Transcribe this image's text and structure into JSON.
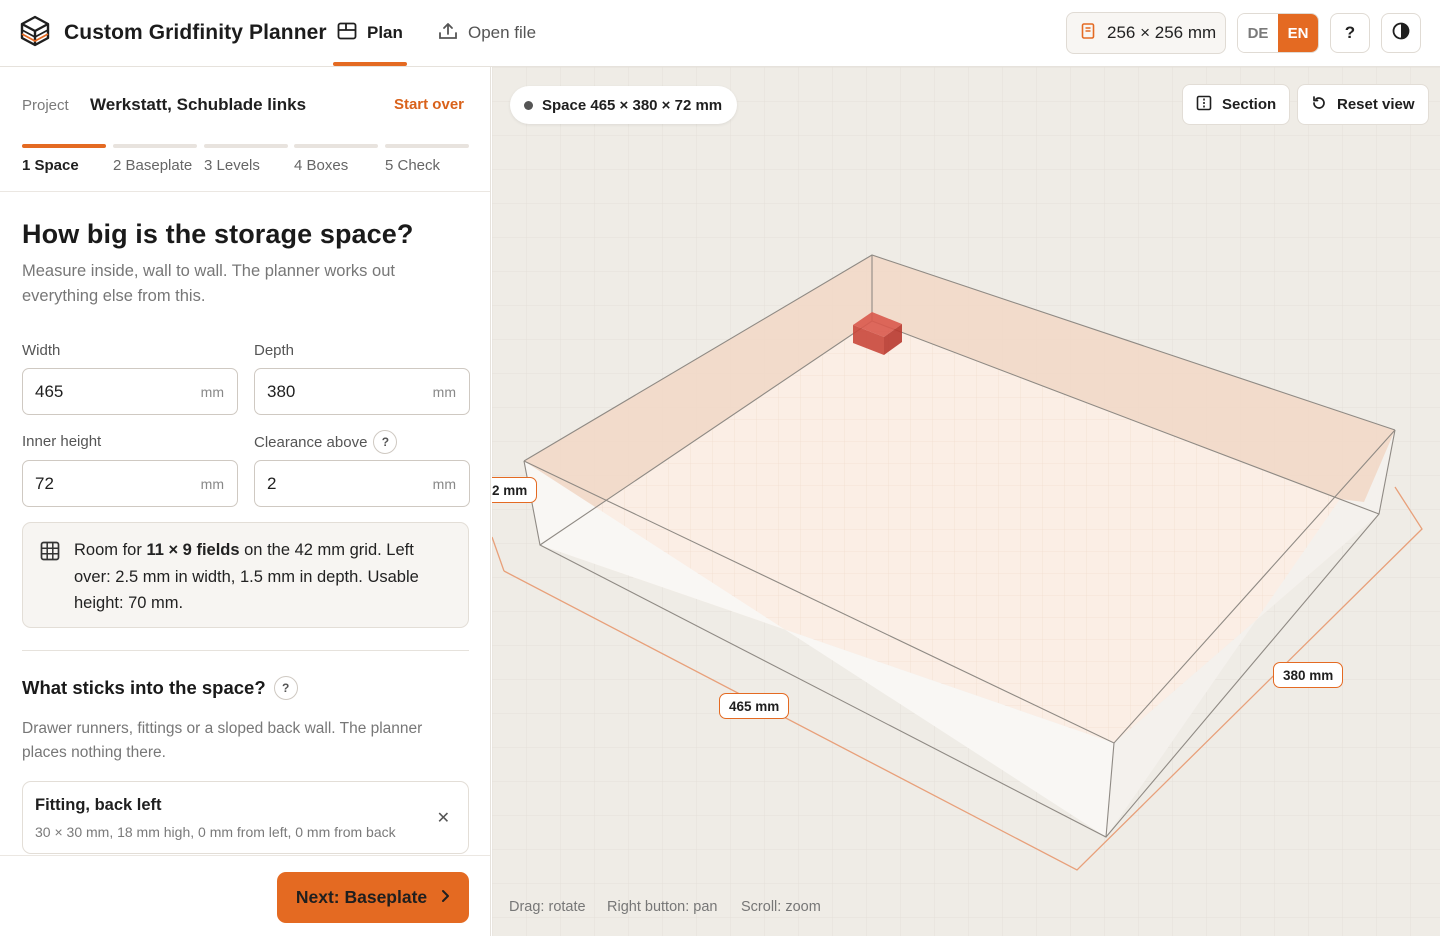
{
  "app": {
    "title": "Custom Gridfinity Planner"
  },
  "nav": {
    "plan": "Plan",
    "open_file": "Open file"
  },
  "header": {
    "grid_size": "256 × 256 mm",
    "lang_de": "DE",
    "lang_en": "EN",
    "help": "?"
  },
  "project": {
    "label": "Project",
    "name": "Werkstatt, Schublade links",
    "start_over": "Start over"
  },
  "steps": [
    {
      "label": "1  Space"
    },
    {
      "label": "2  Baseplate"
    },
    {
      "label": "3  Levels"
    },
    {
      "label": "4  Boxes"
    },
    {
      "label": "5  Check"
    }
  ],
  "space": {
    "heading": "How big is the storage space?",
    "subtitle": "Measure inside, wall to wall. The planner works out everything else from this.",
    "width_label": "Width",
    "width_value": "465",
    "depth_label": "Depth",
    "depth_value": "380",
    "height_label": "Inner height",
    "height_value": "72",
    "clearance_label": "Clearance above",
    "clearance_value": "2",
    "unit": "mm"
  },
  "info": {
    "prefix": "Room for ",
    "fields": "11 × 9 fields",
    "suffix": " on the 42 mm grid. Left over: 2.5 mm in width, 1.5 mm in depth. Usable height: 70 mm."
  },
  "obstacles": {
    "heading": "What sticks into the space?",
    "subtitle": "Drawer runners, fittings or a sloped back wall. The planner places nothing there.",
    "items": [
      {
        "title": "Fitting, back left",
        "desc": "30 × 30 mm, 18 mm high, 0 mm from left, 0 mm from back"
      }
    ]
  },
  "footer": {
    "next_label": "Next: Baseplate"
  },
  "viewport": {
    "space_pill": "Space 465 × 380 × 72 mm",
    "section_label": "Section",
    "reset_label": "Reset view",
    "dim_width": "465 mm",
    "dim_depth": "380 mm",
    "dim_height": "2 mm",
    "hint_drag": "Drag: rotate",
    "hint_pan": "Right button: pan",
    "hint_zoom": "Scroll: zoom"
  },
  "colors": {
    "accent": "#e46a22"
  }
}
